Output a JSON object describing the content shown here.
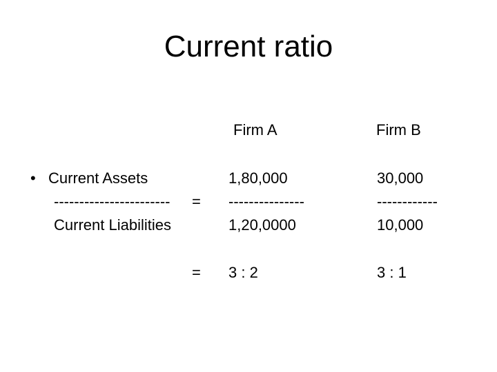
{
  "slide": {
    "title": "Current ratio",
    "columns": [
      "Firm A",
      "Firm B"
    ],
    "bullet": "•",
    "formula": {
      "numerator": "Current Assets",
      "divider": "-----------------------",
      "equals": "=",
      "denominator": "Current Liabilities"
    },
    "firm_a": {
      "numerator": "1,80,000",
      "divider": "---------------",
      "denominator": "1,20,0000",
      "ratio": "3 : 2"
    },
    "firm_b": {
      "numerator": "30,000",
      "divider": "------------",
      "denominator": "10,000",
      "ratio": "3 : 1"
    },
    "result_equals": "="
  }
}
